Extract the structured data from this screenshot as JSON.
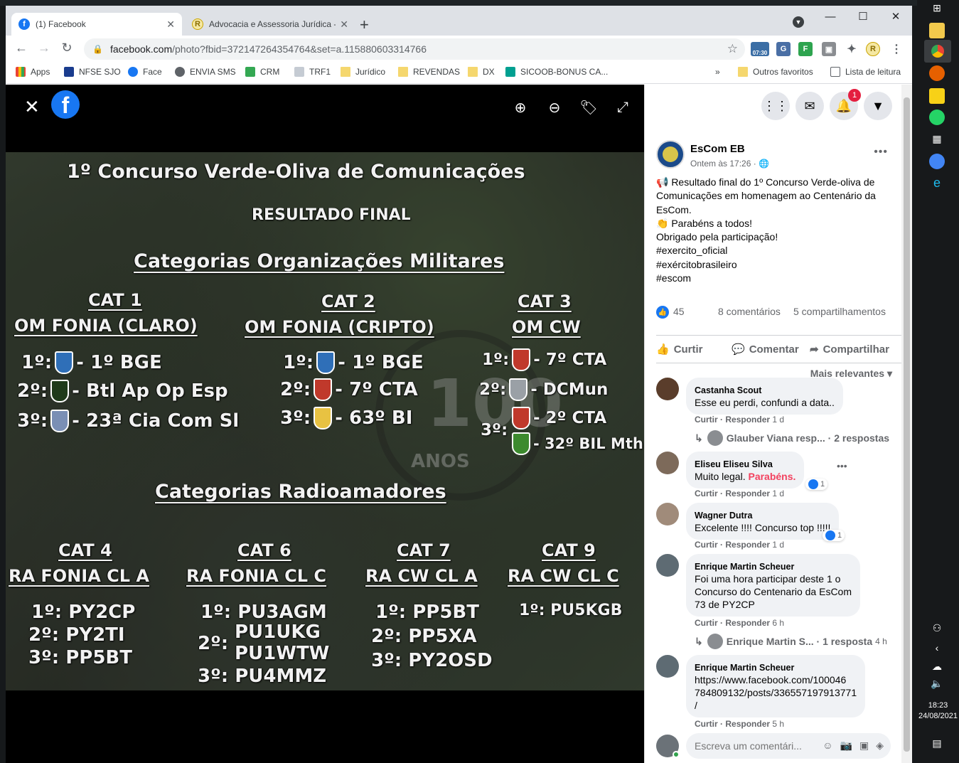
{
  "browser": {
    "tabs": [
      {
        "title": "(1) Facebook",
        "active": true
      },
      {
        "title": "Advocacia e Assessoria Jurídica -",
        "active": false
      }
    ],
    "new_tab": "+",
    "window": {
      "minimize": "—",
      "maximize": "☐",
      "close": "✕"
    },
    "url_host": "facebook.com",
    "url_path": "/photo?fbid=372147264354764&set=a.115880603314766",
    "ext_clock": "07:30",
    "bookmarks": [
      {
        "label": "Apps"
      },
      {
        "label": "NFSE SJO"
      },
      {
        "label": "Face"
      },
      {
        "label": "ENVIA SMS"
      },
      {
        "label": "CRM"
      },
      {
        "label": "TRF1"
      },
      {
        "label": "Jurídico"
      },
      {
        "label": "REVENDAS"
      },
      {
        "label": "DX"
      },
      {
        "label": "SICOOB-BONUS CA..."
      }
    ],
    "bookmarks_more": "»",
    "other_bookmarks": "Outros favoritos",
    "reading_list": "Lista de leitura"
  },
  "photo": {
    "title": "1º Concurso Verde-Oliva de Comunicações",
    "subtitle": "RESULTADO FINAL",
    "section1": "Categorias Organizações Militares",
    "section2": "Categorias Radioamadores",
    "watermark": "100",
    "watermark_sub": "ANOS",
    "om_cats": [
      {
        "cat": "CAT 1",
        "name": "OM FONIA (CLARO)",
        "results": [
          "1º:",
          "- 1º BGE",
          "2º:",
          "- Btl Ap Op Esp",
          "3º:",
          "- 23ª Cia Com Sl"
        ]
      },
      {
        "cat": "CAT 2",
        "name": "OM FONIA (CRIPTO)",
        "results": [
          "1º:",
          "- 1º BGE",
          "2º:",
          "- 7º CTA",
          "3º:",
          "- 63º BI"
        ]
      },
      {
        "cat": "CAT 3",
        "name": "OM CW",
        "results": [
          "1º:",
          "- 7º CTA",
          "2º:",
          "- DCMun",
          "3º:",
          "- 2º CTA",
          "- 32º BIL Mth"
        ]
      }
    ],
    "ra_cats": [
      {
        "cat": "CAT 4",
        "name": "RA FONIA CL A",
        "results": [
          "1º: PY2CP",
          "2º: PY2TI",
          "3º: PP5BT"
        ]
      },
      {
        "cat": "CAT 6",
        "name": "RA FONIA CL C",
        "results": [
          "1º: PU3AGM",
          "2º:",
          "PU1UKG",
          "PU1WTW",
          "3º: PU4MMZ"
        ]
      },
      {
        "cat": "CAT 7",
        "name": "RA CW CL A",
        "results": [
          "1º: PP5BT",
          "2º: PP5XA",
          "3º: PY2OSD"
        ]
      },
      {
        "cat": "CAT 9",
        "name": "RA CW CL C",
        "results": [
          "1º: PU5KGB"
        ]
      }
    ],
    "badge_colors": [
      "#2f6fb8",
      "#1f3a1a",
      "#7a8fb5",
      "#2f6fb8",
      "#c0392b",
      "#e8c242",
      "#c0392b",
      "#9aa0a6",
      "#c0392b",
      "#3c8a2e"
    ]
  },
  "header_icons": {
    "notifications_count": "1"
  },
  "post": {
    "author": "EsCom EB",
    "time": "Ontem às 17:26 ·",
    "lines": [
      "📢 Resultado final do 1º Concurso Verde-oliva de",
      "Comunicações em homenagem ao Centenário da",
      "EsCom.",
      "👏 Parabéns a todos!",
      "Obrigado pela participação!"
    ],
    "hashtags": [
      "#exercito_oficial",
      "#exércitobrasileiro",
      "#escom"
    ],
    "likes": "45",
    "comments_count": "8 comentários",
    "shares_count": "5 compartilhamentos",
    "actions": {
      "like": "Curtir",
      "comment": "Comentar",
      "share": "Compartilhar"
    },
    "sort": "Mais relevantes",
    "avatar_color": "#1b4a8a"
  },
  "comments": [
    {
      "name": "Castanha Scout",
      "lines": [
        "Esse eu perdi, confundi a data.."
      ],
      "time": "1 d",
      "avatar_color": "#5a3d2b",
      "reply": {
        "who": "Glauber Viana resp...",
        "count": "· 2 respostas",
        "time": ""
      }
    },
    {
      "name": "Eliseu Eliseu Silva",
      "lines": [
        "Muito legal."
      ],
      "highlight": "Parabéns.",
      "time": "1 d",
      "reacts": "1",
      "avatar_color": "#7d6a5a"
    },
    {
      "name": "Wagner Dutra",
      "lines": [
        "Excelente !!!! Concurso top !!!!!"
      ],
      "time": "1 d",
      "reacts": "1",
      "avatar_color": "#a08b7a"
    },
    {
      "name": "Enrique Martin Scheuer",
      "lines": [
        "Foi uma hora participar deste 1 o",
        "Concurso do Centenario da EsCom",
        "73 de PY2CP"
      ],
      "time": "6 h",
      "avatar_color": "#5e6b73",
      "reply": {
        "who": "Enrique Martin S...",
        "count": "· 1 resposta",
        "time": "4 h"
      }
    },
    {
      "name": "Enrique Martin Scheuer",
      "lines": [
        "https://www.facebook.com/100046",
        "784809132/posts/336557197913771",
        "/"
      ],
      "time": "5 h",
      "avatar_color": "#5e6b73"
    }
  ],
  "comment_actions": {
    "like": "Curtir",
    "reply": "Responder",
    "sep": "·"
  },
  "write_comment": {
    "placeholder": "Escreva um comentári..."
  },
  "taskbar": {
    "time": "18:23",
    "date": "24/08/2021"
  }
}
